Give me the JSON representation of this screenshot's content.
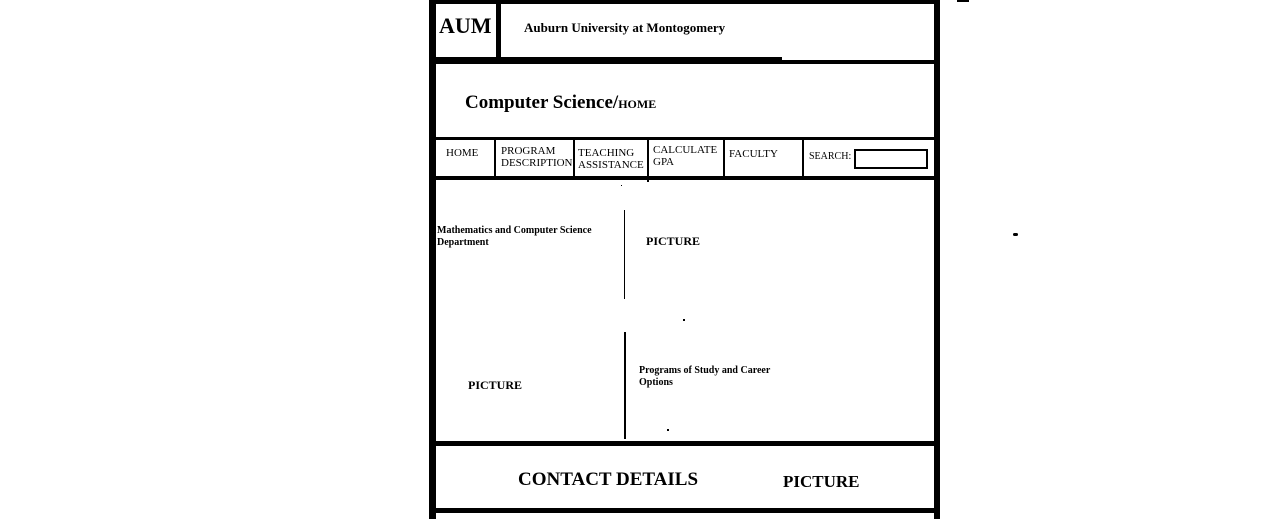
{
  "header": {
    "logo": "AUM",
    "university": "Auburn University at Montogomery"
  },
  "title": {
    "main": "Computer Science/",
    "sub": "HOME"
  },
  "nav": {
    "home": "HOME",
    "program_description": [
      "PROGRAM",
      "DESCRIPTION"
    ],
    "teaching_assistance": [
      "TEACHING",
      "ASSISTANCE"
    ],
    "calculate_gpa": [
      "CALCULATE",
      "GPA"
    ],
    "faculty": "FACULTY",
    "search_label": "SEARCH:",
    "search_value": ""
  },
  "content": {
    "department": [
      "Mathematics and Computer Science",
      "Department"
    ],
    "picture_top": "PICTURE",
    "picture_left": "PICTURE",
    "programs": [
      "Programs of Study and Career",
      "Options"
    ]
  },
  "footer": {
    "contact": "CONTACT DETAILS",
    "picture": "PICTURE"
  }
}
